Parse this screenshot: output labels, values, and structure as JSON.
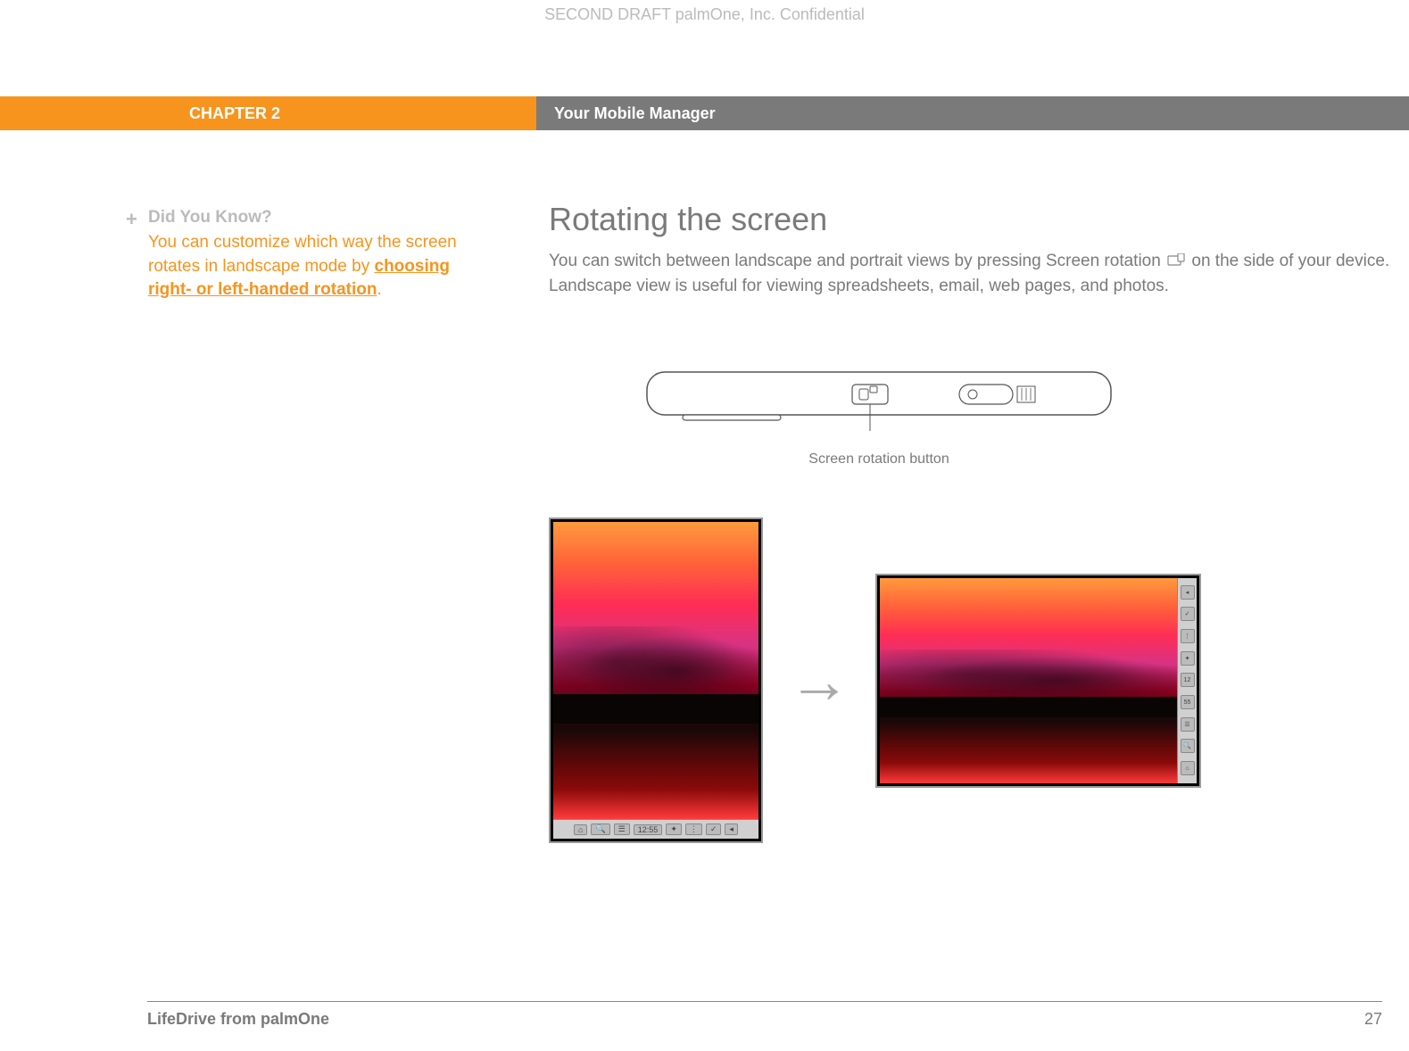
{
  "header": {
    "confidential": "SECOND DRAFT palmOne, Inc.  Confidential"
  },
  "chapter": {
    "label": "CHAPTER 2",
    "title": "Your Mobile Manager"
  },
  "sidebar": {
    "dykTitle": "Did You Know?",
    "dykBody": "You can customize which way the screen rotates in landscape mode by ",
    "dykLink": "choosing right- or left-handed rotation",
    "dykEnd": "."
  },
  "main": {
    "title": "Rotating the screen",
    "body1": "You can switch between landscape and portrait views by pressing Screen rotation ",
    "body2": " on the side of your device. Landscape view is useful for viewing spreadsheets, email, web pages, and photos."
  },
  "diagram": {
    "label": "Screen rotation button"
  },
  "taskbar": {
    "time": "12:55",
    "time1": "12",
    "time2": "55"
  },
  "footer": {
    "product": "LifeDrive from palmOne",
    "pageNum": "27"
  }
}
